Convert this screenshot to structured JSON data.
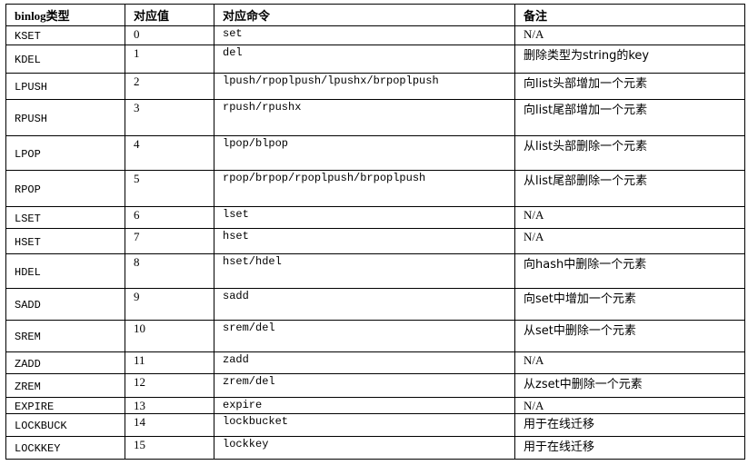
{
  "headers": [
    "binlog类型",
    "对应值",
    "对应命令",
    "备注"
  ],
  "rows": [
    {
      "type": "KSET",
      "value": "0",
      "command": "set",
      "note": "N/A"
    },
    {
      "type": "KDEL",
      "value": "1",
      "command": "del",
      "note": "删除类型为string的key"
    },
    {
      "type": "LPUSH",
      "value": "2",
      "command": "lpush/rpoplpush/lpushx/brpoplpush",
      "note": "向list头部增加一个元素"
    },
    {
      "type": "RPUSH",
      "value": "3",
      "command": "rpush/rpushx",
      "note": "向list尾部增加一个元素"
    },
    {
      "type": "LPOP",
      "value": "4",
      "command": "lpop/blpop",
      "note": "从list头部删除一个元素"
    },
    {
      "type": "RPOP",
      "value": "5",
      "command": "rpop/brpop/rpoplpush/brpoplpush",
      "note": "从list尾部删除一个元素"
    },
    {
      "type": "LSET",
      "value": "6",
      "command": "lset",
      "note": "N/A"
    },
    {
      "type": "HSET",
      "value": "7",
      "command": "hset",
      "note": "N/A"
    },
    {
      "type": "HDEL",
      "value": "8",
      "command": "hset/hdel",
      "note": "向hash中删除一个元素"
    },
    {
      "type": "SADD",
      "value": "9",
      "command": "sadd",
      "note": "向set中增加一个元素"
    },
    {
      "type": "SREM",
      "value": "10",
      "command": "srem/del",
      "note": "从set中删除一个元素"
    },
    {
      "type": "ZADD",
      "value": "11",
      "command": "zadd",
      "note": "N/A"
    },
    {
      "type": "ZREM",
      "value": "12",
      "command": "zrem/del",
      "note": "从zset中删除一个元素"
    },
    {
      "type": "EXPIRE",
      "value": "13",
      "command": "expire",
      "note": "N/A"
    },
    {
      "type": "LOCKBUCK",
      "value": "14",
      "command": "lockbucket",
      "note": "用于在线迁移"
    },
    {
      "type": "LOCKKEY",
      "value": "15",
      "command": "lockkey",
      "note": "用于在线迁移"
    }
  ]
}
